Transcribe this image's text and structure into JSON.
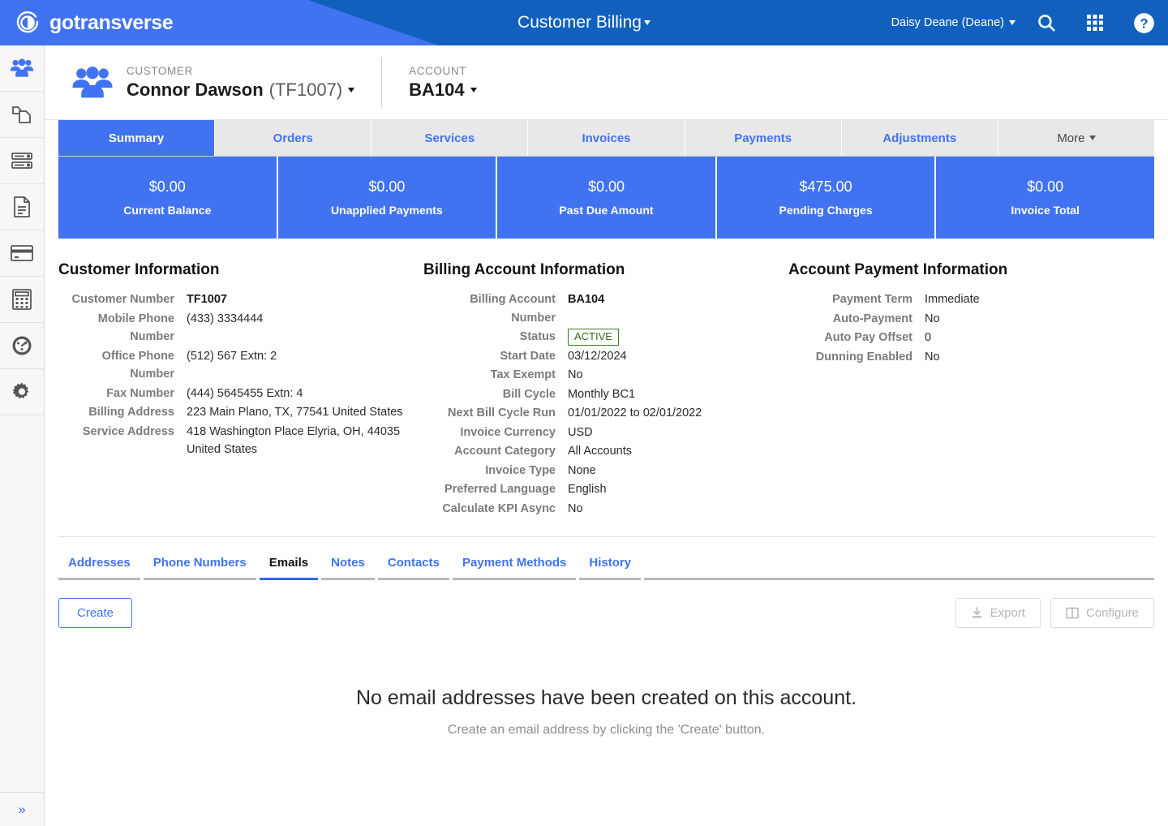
{
  "header": {
    "brand": "gotransverse",
    "brand_logo_icon": "gotransverse-circle-logo",
    "app_title": "Customer Billing",
    "user_name": "Daisy Deane (Deane)",
    "icons": {
      "search": "search-icon",
      "apps": "apps-grid-icon",
      "help": "help-circle-icon"
    },
    "colors": {
      "primary_dark": "#1160bd",
      "primary_light": "#4173f0"
    }
  },
  "sidebar": {
    "items": [
      {
        "name": "customers",
        "icon": "people-group-icon",
        "active": true
      },
      {
        "name": "orders",
        "icon": "copy-pages-icon",
        "active": false
      },
      {
        "name": "services",
        "icon": "server-stack-icon",
        "active": false
      },
      {
        "name": "invoices",
        "icon": "document-lines-icon",
        "active": false
      },
      {
        "name": "payments",
        "icon": "credit-card-icon",
        "active": false
      },
      {
        "name": "adjustments",
        "icon": "calculator-icon",
        "active": false
      },
      {
        "name": "dashboard",
        "icon": "gauge-speedometer-icon",
        "active": false
      },
      {
        "name": "settings",
        "icon": "gear-icon",
        "active": false
      }
    ],
    "expand_icon": "double-chevron-right-icon"
  },
  "record_header": {
    "avatar_icon": "people-group-icon",
    "customer_label": "CUSTOMER",
    "customer_name": "Connor Dawson",
    "customer_number_paren": "(TF1007)",
    "account_label": "ACCOUNT",
    "account_value": "BA104"
  },
  "tabs": [
    {
      "label": "Summary",
      "active": true
    },
    {
      "label": "Orders",
      "active": false
    },
    {
      "label": "Services",
      "active": false
    },
    {
      "label": "Invoices",
      "active": false
    },
    {
      "label": "Payments",
      "active": false
    },
    {
      "label": "Adjustments",
      "active": false
    },
    {
      "label": "More",
      "active": false,
      "has_caret": true
    }
  ],
  "kpis": [
    {
      "amount": "$0.00",
      "label": "Current Balance"
    },
    {
      "amount": "$0.00",
      "label": "Unapplied Payments"
    },
    {
      "amount": "$0.00",
      "label": "Past Due Amount"
    },
    {
      "amount": "$475.00",
      "label": "Pending Charges"
    },
    {
      "amount": "$0.00",
      "label": "Invoice Total"
    }
  ],
  "customer_information": {
    "title": "Customer Information",
    "rows": [
      {
        "label": "Customer Number",
        "value": "TF1007",
        "strong": true
      },
      {
        "label": "Mobile Phone Number",
        "value": "(433) 3334444"
      },
      {
        "label": "Office Phone Number",
        "value": "(512) 567 Extn: 2"
      },
      {
        "label": "Fax Number",
        "value": "(444) 5645455 Extn: 4"
      },
      {
        "label": "Billing Address",
        "value": "223 Main Plano, TX, 77541 United States"
      },
      {
        "label": "Service Address",
        "value": "418 Washington Place Elyria, OH, 44035 United States"
      }
    ]
  },
  "billing_account_information": {
    "title": "Billing Account Information",
    "rows": [
      {
        "label": "Billing Account Number",
        "value": "BA104",
        "strong": true
      },
      {
        "label": "Status",
        "value": "ACTIVE",
        "badge": true
      },
      {
        "label": "Start Date",
        "value": "03/12/2024"
      },
      {
        "label": "Tax Exempt",
        "value": "No"
      },
      {
        "label": "Bill Cycle",
        "value": "Monthly BC1"
      },
      {
        "label": "Next Bill Cycle Run",
        "value": "01/01/2022 to 02/01/2022"
      },
      {
        "label": "Invoice Currency",
        "value": "USD"
      },
      {
        "label": "Account Category",
        "value": "All Accounts"
      },
      {
        "label": "Invoice Type",
        "value": "None"
      },
      {
        "label": "Preferred Language",
        "value": "English"
      },
      {
        "label": "Calculate KPI Async",
        "value": "No"
      }
    ]
  },
  "account_payment_information": {
    "title": "Account Payment Information",
    "rows": [
      {
        "label": "Payment Term",
        "value": "Immediate"
      },
      {
        "label": "Auto-Payment",
        "value": "No"
      },
      {
        "label": "Auto Pay Offset",
        "value": "0"
      },
      {
        "label": "Dunning Enabled",
        "value": "No"
      }
    ]
  },
  "subtabs": [
    {
      "label": "Addresses",
      "active": false
    },
    {
      "label": "Phone Numbers",
      "active": false
    },
    {
      "label": "Emails",
      "active": true
    },
    {
      "label": "Notes",
      "active": false
    },
    {
      "label": "Contacts",
      "active": false
    },
    {
      "label": "Payment Methods",
      "active": false
    },
    {
      "label": "History",
      "active": false
    }
  ],
  "actions": {
    "create_label": "Create",
    "export_label": "Export",
    "export_icon": "download-icon",
    "configure_label": "Configure",
    "configure_icon": "columns-icon"
  },
  "empty_state": {
    "title": "No email addresses have been created on this account.",
    "subtitle": "Create an email address by clicking the 'Create' button."
  }
}
